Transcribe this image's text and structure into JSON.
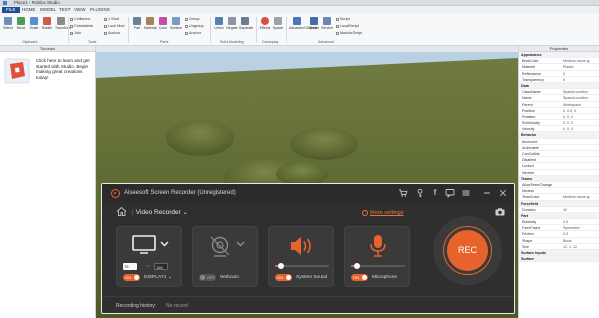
{
  "studio": {
    "title": "Place1 - Roblox Studio",
    "menu": {
      "file": "FILE",
      "tabs": [
        "HOME",
        "MODEL",
        "TEST",
        "VIEW",
        "PLUGINS"
      ]
    },
    "ribbon": {
      "buttons": [
        "Select",
        "Move",
        "Scale",
        "Rotate",
        "Transform",
        "Part",
        "Material",
        "Color",
        "Surface",
        "Union",
        "Negate",
        "Separate",
        "Effects",
        "Spawn",
        "Advanced Objects",
        "Model",
        "Service"
      ],
      "small_left": [
        "Collisions",
        "Constraints",
        "Join",
        "1 Stud",
        "Lock Mod",
        "Anchor",
        "Group",
        "Ungroup",
        "Anchor"
      ],
      "small_right": [
        "Script",
        "LocalScript",
        "ModuleScript"
      ],
      "groups": [
        "Clipboard",
        "Tools",
        "Parts",
        "Solid Modeling",
        "Gameplay",
        "Advanced"
      ]
    },
    "left_panel": {
      "header": "Tutorials",
      "text": "Click here to learn and get started with Studio. Begin making great creations today!"
    },
    "right_panel": {
      "header": "Properties",
      "rows": [
        {
          "k": "Appearance",
          "v": "",
          "section": true
        },
        {
          "k": "BrickColor",
          "v": "Medium stone gr",
          "section": false
        },
        {
          "k": "Material",
          "v": "Plastic",
          "section": false
        },
        {
          "k": "Reflectance",
          "v": "0",
          "section": false
        },
        {
          "k": "Transparency",
          "v": "0",
          "section": false
        },
        {
          "k": "Data",
          "v": "",
          "section": true
        },
        {
          "k": "ClassName",
          "v": "SpawnLocation",
          "section": false
        },
        {
          "k": "Name",
          "v": "SpawnLocation",
          "section": false
        },
        {
          "k": "Parent",
          "v": "Workspace",
          "section": false
        },
        {
          "k": "Position",
          "v": "0, 0.5, 0",
          "section": false
        },
        {
          "k": "Rotation",
          "v": "0, 0, 0",
          "section": false
        },
        {
          "k": "RotVelocity",
          "v": "0, 0, 0",
          "section": false
        },
        {
          "k": "Velocity",
          "v": "0, 0, 0",
          "section": false
        },
        {
          "k": "Behavior",
          "v": "",
          "section": true
        },
        {
          "k": "Anchored",
          "v": "",
          "section": false
        },
        {
          "k": "Archivable",
          "v": "",
          "section": false
        },
        {
          "k": "CanCollide",
          "v": "",
          "section": false
        },
        {
          "k": "Disabled",
          "v": "",
          "section": false
        },
        {
          "k": "Locked",
          "v": "",
          "section": false
        },
        {
          "k": "Neutral",
          "v": "",
          "section": false
        },
        {
          "k": "Teams",
          "v": "",
          "section": true
        },
        {
          "k": "AllowTeamChange",
          "v": "",
          "section": false
        },
        {
          "k": "Neutral",
          "v": "",
          "section": false
        },
        {
          "k": "TeamColor",
          "v": "Medium stone gr",
          "section": false
        },
        {
          "k": "Forcefield",
          "v": "",
          "section": true
        },
        {
          "k": "Duration",
          "v": "10",
          "section": false
        },
        {
          "k": "Part",
          "v": "",
          "section": true
        },
        {
          "k": "Elasticity",
          "v": "0.5",
          "section": false
        },
        {
          "k": "FormFactor",
          "v": "Symmetric",
          "section": false
        },
        {
          "k": "Friction",
          "v": "0.3",
          "section": false
        },
        {
          "k": "Shape",
          "v": "Block",
          "section": false
        },
        {
          "k": "Size",
          "v": "12, 1, 12",
          "section": false
        },
        {
          "k": "Surface Inputs",
          "v": "",
          "section": true
        },
        {
          "k": "Surface",
          "v": "",
          "section": true
        }
      ]
    }
  },
  "recorder": {
    "app_name": "Aiseesoft Screen Recorder (Unregistered)",
    "title_icons": [
      "cart-icon",
      "key-icon",
      "facebook-icon",
      "chat-icon",
      "menu-icon",
      "minimize-icon",
      "close-icon"
    ],
    "mode": "Video Recorder",
    "more_settings": "More settings",
    "display": {
      "toggle": "ON",
      "label": "DISPLAY1",
      "width": "79",
      "height": "166"
    },
    "webcam": {
      "toggle": "OFF",
      "label": "Webcam"
    },
    "system_sound": {
      "toggle": "ON",
      "label": "System Sound",
      "level": 0.12
    },
    "microphone": {
      "toggle": "ON",
      "label": "Microphone",
      "level": 0.12
    },
    "rec_label": "REC",
    "history_label": "Recording history:",
    "history_value": "No record",
    "accent": "#e8632b"
  }
}
